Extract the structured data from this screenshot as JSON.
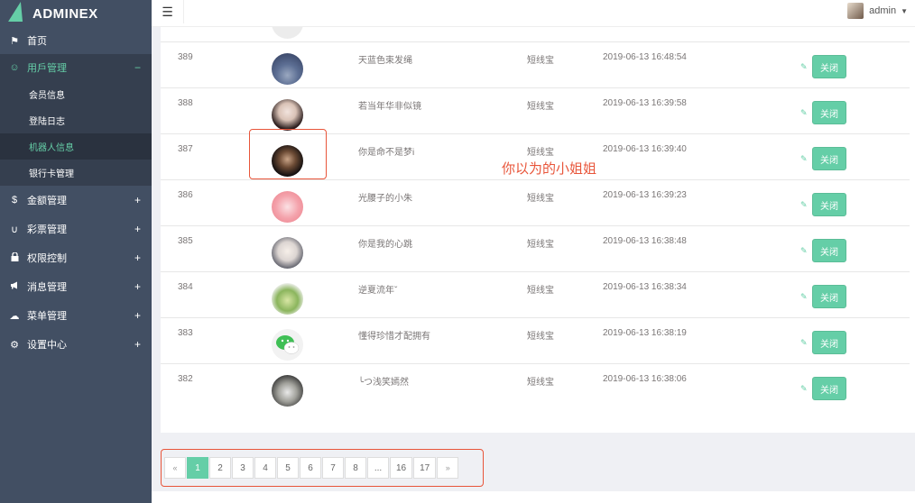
{
  "app": {
    "brand_a": "ADMIN",
    "brand_b": "EX"
  },
  "header": {
    "menu_icon": "menu-icon",
    "user": "admin"
  },
  "sidebar": {
    "items": [
      {
        "label": "首页",
        "icon": "flag-icon",
        "glyph": "⚑"
      },
      {
        "label": "用戶管理",
        "icon": "smile-icon",
        "glyph": "☺",
        "toggle": "−"
      },
      {
        "label": "金额管理",
        "icon": "dollar-icon",
        "glyph": "$",
        "toggle": "+"
      },
      {
        "label": "彩票管理",
        "icon": "magnet-icon",
        "glyph": "∪",
        "toggle": "+"
      },
      {
        "label": "权限控制",
        "icon": "lock-icon",
        "glyph": "🔒",
        "toggle": "+"
      },
      {
        "label": "消息管理",
        "icon": "bullhorn-icon",
        "glyph": "📢",
        "toggle": "+"
      },
      {
        "label": "菜单管理",
        "icon": "cloud-icon",
        "glyph": "☁",
        "toggle": "+"
      },
      {
        "label": "设置中心",
        "icon": "gear-icon",
        "glyph": "⚙",
        "toggle": "+"
      }
    ],
    "sub": [
      "会员信息",
      "登陆日志",
      "机器人信息",
      "银行卡管理"
    ]
  },
  "table": {
    "rows": [
      {
        "id": "389",
        "name": "天蓝色束发绳",
        "type": "短线宝",
        "time": "2019-06-13 16:48:54"
      },
      {
        "id": "388",
        "name": "若当年华非似镜",
        "type": "短线宝",
        "time": "2019-06-13 16:39:58"
      },
      {
        "id": "387",
        "name": "你是命不是梦i",
        "type": "短线宝",
        "time": "2019-06-13 16:39:40"
      },
      {
        "id": "386",
        "name": "光腰子的小朱",
        "type": "短线宝",
        "time": "2019-06-13 16:39:23"
      },
      {
        "id": "385",
        "name": "你是我的心跳",
        "type": "短线宝",
        "time": "2019-06-13 16:38:48"
      },
      {
        "id": "384",
        "name": "逆夏流年ˇ",
        "type": "短线宝",
        "time": "2019-06-13 16:38:34"
      },
      {
        "id": "383",
        "name": "懂得珍惜才配拥有",
        "type": "短线宝",
        "time": "2019-06-13 16:38:19"
      },
      {
        "id": "382",
        "name": "╰つ浅笑嫣然",
        "type": "短线宝",
        "time": "2019-06-13 16:38:06"
      }
    ],
    "action_label": "关闭"
  },
  "annotation": "你以为的小姐姐",
  "pager": {
    "prev": "«",
    "pages": [
      "1",
      "2",
      "3",
      "4",
      "5",
      "6",
      "7",
      "8",
      "...",
      "16",
      "17"
    ],
    "next": "»",
    "active": "1"
  },
  "colors": {
    "accent": "#65cea7",
    "sidebar": "#424f63",
    "highlight": "#e8553a"
  }
}
